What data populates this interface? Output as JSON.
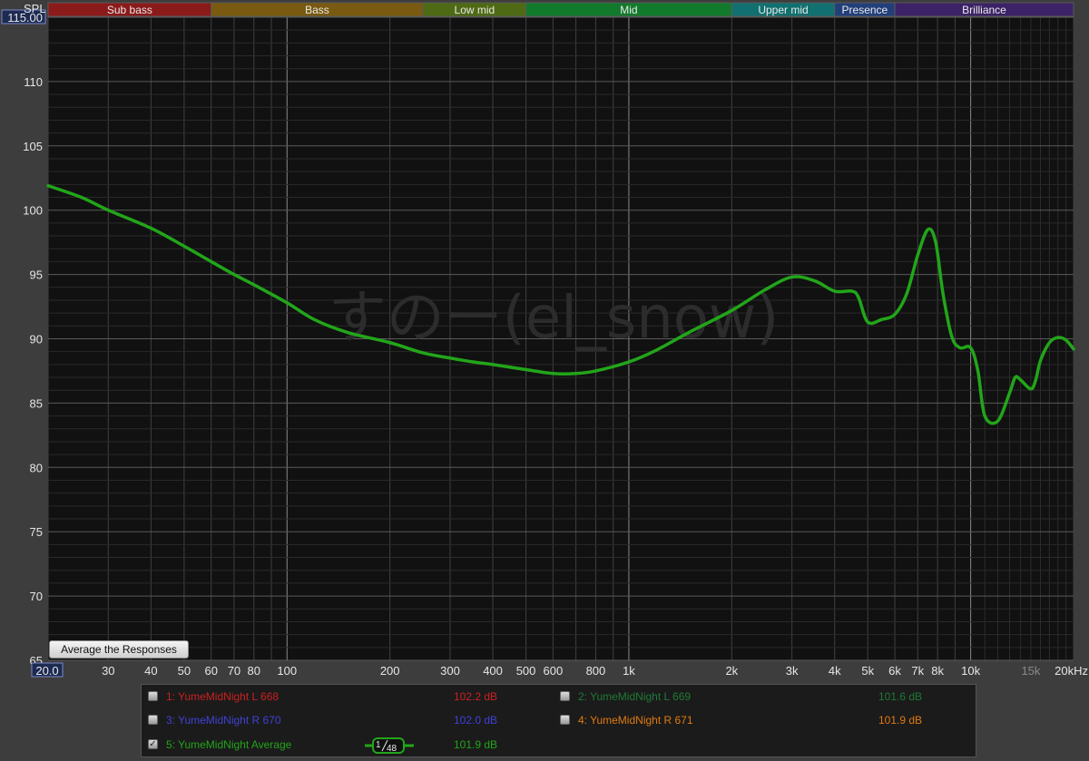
{
  "chart_data": {
    "type": "line",
    "ylabel": "SPL",
    "ylim": [
      65,
      115
    ],
    "xlim": [
      20,
      20000
    ],
    "x_scale": "log",
    "grid": true,
    "y_ticks": [
      "115.00",
      "110",
      "105",
      "100",
      "95",
      "90",
      "85",
      "80",
      "75",
      "70",
      "65"
    ],
    "x_ticks": [
      {
        "f": 20,
        "label": "20.0"
      },
      {
        "f": 30,
        "label": "30"
      },
      {
        "f": 40,
        "label": "40"
      },
      {
        "f": 50,
        "label": "50"
      },
      {
        "f": 60,
        "label": "60"
      },
      {
        "f": 70,
        "label": "70"
      },
      {
        "f": 80,
        "label": "80"
      },
      {
        "f": 100,
        "label": "100"
      },
      {
        "f": 200,
        "label": "200"
      },
      {
        "f": 300,
        "label": "300"
      },
      {
        "f": 400,
        "label": "400"
      },
      {
        "f": 500,
        "label": "500"
      },
      {
        "f": 600,
        "label": "600"
      },
      {
        "f": 800,
        "label": "800"
      },
      {
        "f": 1000,
        "label": "1k"
      },
      {
        "f": 2000,
        "label": "2k"
      },
      {
        "f": 3000,
        "label": "3k"
      },
      {
        "f": 4000,
        "label": "4k"
      },
      {
        "f": 5000,
        "label": "5k"
      },
      {
        "f": 6000,
        "label": "6k"
      },
      {
        "f": 7000,
        "label": "7k"
      },
      {
        "f": 8000,
        "label": "8k"
      },
      {
        "f": 10000,
        "label": "10k"
      },
      {
        "f": 15000,
        "label": "15k"
      },
      {
        "f": 20000,
        "label": "20kHz"
      }
    ],
    "bands": [
      {
        "name": "Sub bass",
        "from": 20,
        "to": 60,
        "color": "#8b1a1a"
      },
      {
        "name": "Bass",
        "from": 60,
        "to": 250,
        "color": "#7a5a10"
      },
      {
        "name": "Low mid",
        "from": 250,
        "to": 500,
        "color": "#4f6a14"
      },
      {
        "name": "Mid",
        "from": 500,
        "to": 2000,
        "color": "#127a2c"
      },
      {
        "name": "Upper mid",
        "from": 2000,
        "to": 4000,
        "color": "#127070"
      },
      {
        "name": "Presence",
        "from": 4000,
        "to": 6000,
        "color": "#223f7a"
      },
      {
        "name": "Brilliance",
        "from": 6000,
        "to": 20000,
        "color": "#3c2266"
      }
    ],
    "series": [
      {
        "name": "5: YumeMidNight Average",
        "color": "#22a51a",
        "x": [
          20,
          25,
          30,
          40,
          50,
          60,
          70,
          80,
          100,
          120,
          150,
          200,
          250,
          300,
          350,
          400,
          500,
          600,
          700,
          800,
          1000,
          1200,
          1500,
          2000,
          2500,
          3000,
          3500,
          4000,
          4500,
          4700,
          5000,
          5500,
          6000,
          6500,
          7000,
          7500,
          7900,
          8300,
          8800,
          9300,
          10000,
          10500,
          11000,
          12000,
          13000,
          13500,
          14000,
          15000,
          15500,
          16000,
          17000,
          18000,
          19000,
          20000
        ],
        "y": [
          101.9,
          101.0,
          100.0,
          98.6,
          97.2,
          96.0,
          95.0,
          94.2,
          92.8,
          91.5,
          90.5,
          89.7,
          88.9,
          88.5,
          88.2,
          88.0,
          87.6,
          87.3,
          87.3,
          87.5,
          88.2,
          89.1,
          90.5,
          92.2,
          93.8,
          94.8,
          94.5,
          93.7,
          93.7,
          93.2,
          91.3,
          91.5,
          91.9,
          93.5,
          96.5,
          98.5,
          97.5,
          93.5,
          90.2,
          89.3,
          89.3,
          87.5,
          84.0,
          83.6,
          85.8,
          87.0,
          86.8,
          86.1,
          86.8,
          88.3,
          89.7,
          90.1,
          89.9,
          89.2
        ]
      }
    ],
    "legend_entries": [
      {
        "label": "1: YumeMidNight L 668",
        "value": "102.2 dB",
        "color": "#cc2020",
        "checked": false
      },
      {
        "label": "2: YumeMidNight L 669",
        "value": "101.6 dB",
        "color": "#1f7a35",
        "checked": false
      },
      {
        "label": "3: YumeMidNight R 670",
        "value": "102.0 dB",
        "color": "#4040d8",
        "checked": false
      },
      {
        "label": "4: YumeMidNight R 671",
        "value": "101.9 dB",
        "color": "#e07a10",
        "checked": false
      },
      {
        "label": "5: YumeMidNight Average",
        "value": "101.9 dB",
        "color": "#22a51a",
        "checked": true
      }
    ],
    "watermark": "すのー(el_snow)"
  },
  "controls": {
    "average_button": "Average the Responses",
    "smoothing_num": "1",
    "smoothing_den": "48",
    "check_mark": "✓"
  },
  "colors": {
    "plot_bg": "#111111",
    "grid_major": "#8a8a8a",
    "grid_minor": "#3a3a3a",
    "frame": "#3d3d3d",
    "avg_curve": "#22a51a"
  }
}
